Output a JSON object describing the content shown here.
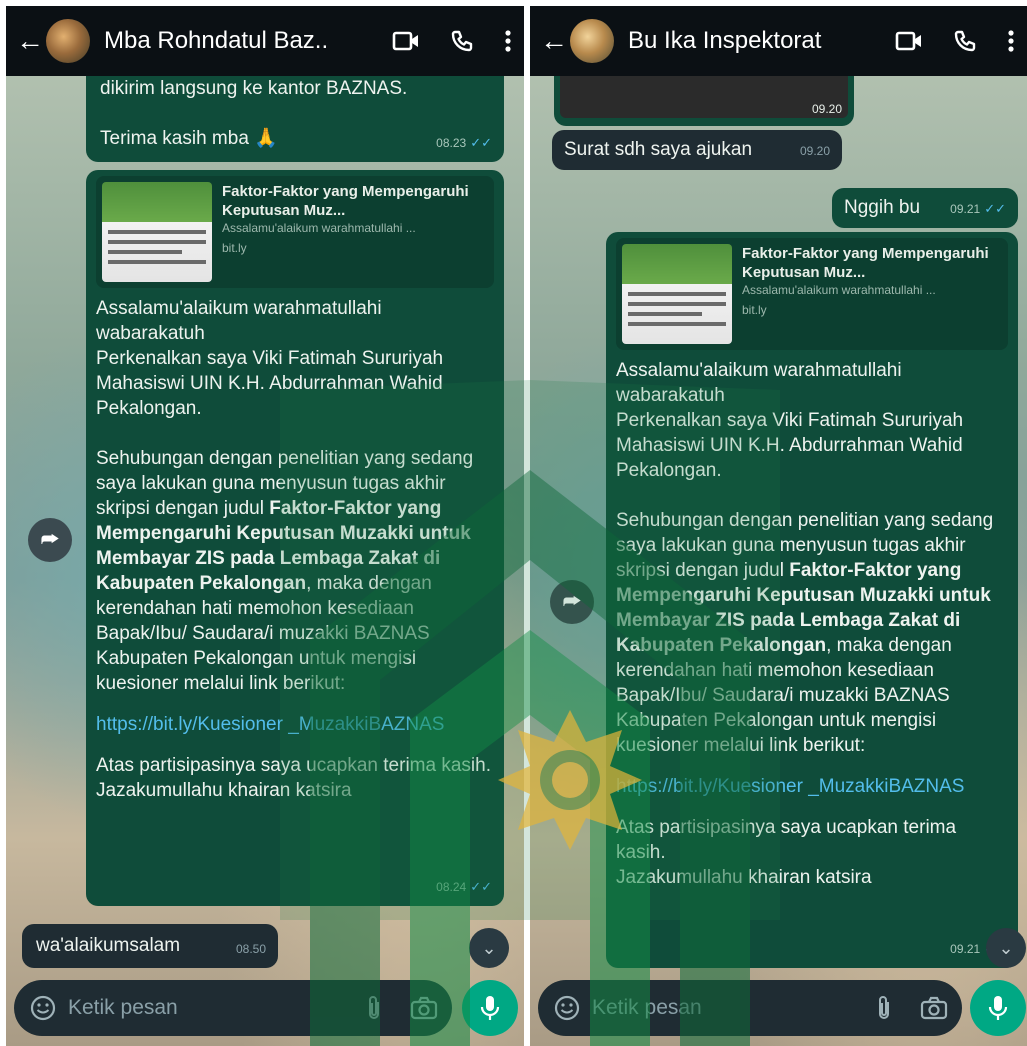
{
  "left": {
    "contact_name": "Mba Rohndatul Baz..",
    "top_message": {
      "text": "dikirim langsung ke kantor BAZNAS.\n\nTerima kasih mba 🙏",
      "time": "08.23"
    },
    "link_preview": {
      "title": "Faktor-Faktor yang Mempengaruhi Keputusan Muz...",
      "description": "Assalamu'alaikum warahmatullahi ...",
      "host": "bit.ly"
    },
    "main_message": {
      "intro": "Assalamu'alaikum warahmatullahi wabarakatuh\nPerkenalkan saya Viki Fatimah Sururiyah Mahasiswi UIN K.H. Abdurrahman Wahid Pekalongan.\n\nSehubungan dengan penelitian yang sedang saya lakukan guna menyusun tugas akhir skripsi dengan judul",
      "bold_title": "Faktor-Faktor yang Mempengaruhi Keputusan Muzakki untuk Membayar ZIS pada Lembaga Zakat di Kabupaten Pekalongan",
      "continuation": ", maka dengan kerendahan hati memohon kesediaan Bapak/Ibu/ Saudara/i muzakki BAZNAS Kabupaten Pekalongan untuk mengisi kuesioner melalui link berikut:",
      "url": "https://bit.ly/Kuesioner _MuzakkiBAZNAS",
      "closing": "Atas partisipasinya saya ucapkan terima kasih.\nJazakumullahu khairan katsira",
      "time": "08.24"
    },
    "reply": {
      "text": "wa'alaikumsalam",
      "time": "08.50"
    },
    "input_placeholder": "Ketik pesan"
  },
  "right": {
    "contact_name": "Bu Ika Inspektorat",
    "image_time": "09.20",
    "incoming": {
      "text": "Surat sdh saya ajukan",
      "time": "09.20"
    },
    "outgoing": {
      "text": "Nggih bu",
      "time": "09.21"
    },
    "link_preview": {
      "title": "Faktor-Faktor yang Mempengaruhi Keputusan Muz...",
      "description": "Assalamu'alaikum warahmatullahi ...",
      "host": "bit.ly"
    },
    "main_message": {
      "intro": "Assalamu'alaikum warahmatullahi wabarakatuh\nPerkenalkan saya Viki Fatimah Sururiyah Mahasiswi UIN K.H. Abdurrahman Wahid Pekalongan.\n\nSehubungan dengan penelitian yang sedang saya lakukan guna menyusun tugas akhir skripsi dengan judul",
      "bold_title": "Faktor-Faktor yang Mempengaruhi Keputusan Muzakki untuk Membayar ZIS pada Lembaga Zakat di Kabupaten Pekalongan",
      "continuation": ", maka dengan kerendahan hati memohon kesediaan Bapak/Ibu/ Saudara/i muzakki BAZNAS Kabupaten Pekalongan untuk mengisi kuesioner melalui link berikut:",
      "url": "https://bit.ly/Kuesioner _MuzakkiBAZNAS",
      "closing": "Atas partisipasinya saya ucapkan terima kasih.\nJazakumullahu khairan katsira",
      "time": "09.21"
    },
    "input_placeholder": "Ketik pesan"
  },
  "colors": {
    "header": "#0b1014",
    "outgoing_bubble": "#0f4c3a",
    "incoming_bubble": "#1f2c33",
    "link": "#53bdeb",
    "accent": "#00a884",
    "watermark_green": "#1b7a45",
    "watermark_gold": "#e3b53a"
  },
  "icons": [
    "back-arrow-icon",
    "video-call-icon",
    "phone-icon",
    "more-vert-icon",
    "forward-icon",
    "scroll-down-icon",
    "emoji-icon",
    "attach-icon",
    "camera-icon",
    "mic-icon",
    "read-ticks-icon"
  ]
}
